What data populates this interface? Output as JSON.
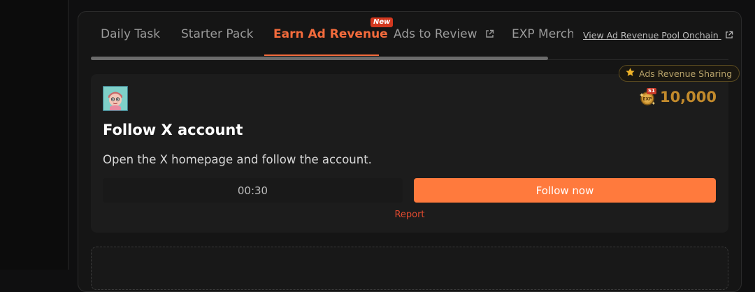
{
  "tabs": [
    {
      "label": "Daily Task",
      "active": false,
      "external": false
    },
    {
      "label": "Starter Pack",
      "active": false,
      "external": false
    },
    {
      "label": "Earn Ad Revenue",
      "active": true,
      "external": false,
      "badge": "New"
    },
    {
      "label": "Ads to Review",
      "active": false,
      "external": true
    },
    {
      "label": "EXP Merch I",
      "active": false,
      "external": false
    }
  ],
  "pool_link": {
    "label": "View Ad Revenue Pool Onchain"
  },
  "sharing_badge": {
    "label": "Ads Revenue Sharing"
  },
  "task": {
    "reward_badge": "S1",
    "reward_amount": "10,000",
    "title": "Follow X account",
    "description": "Open the X homepage and follow the account.",
    "timer": "00:30",
    "action_label": "Follow now",
    "report_label": "Report"
  },
  "colors": {
    "accent": "#f36b3c",
    "button": "#ff7a3d",
    "reward": "#c28a2c",
    "report": "#e04a2f"
  },
  "icons": {
    "external": "external-link-icon",
    "star": "star-icon",
    "coin": "exp-coin-icon",
    "avatar": "advertiser-avatar"
  }
}
